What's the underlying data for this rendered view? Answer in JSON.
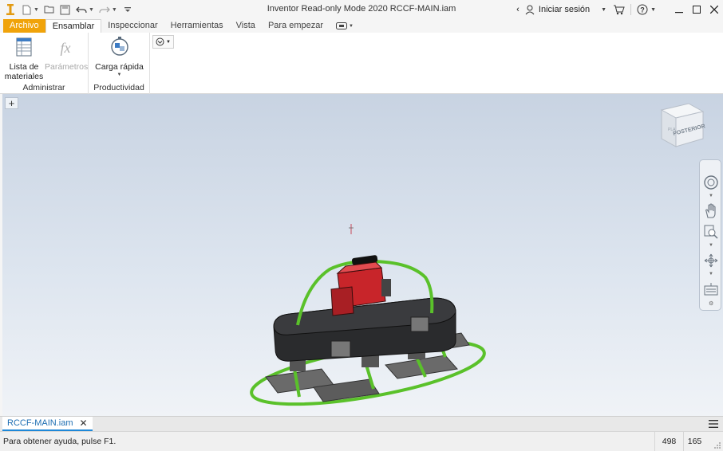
{
  "window": {
    "title": "Inventor Read-only Mode 2020   RCCF-MAIN.iam",
    "sign_in": "Iniciar sesión"
  },
  "tabs": [
    {
      "label": "Archivo"
    },
    {
      "label": "Ensamblar"
    },
    {
      "label": "Inspeccionar"
    },
    {
      "label": "Herramientas"
    },
    {
      "label": "Vista"
    },
    {
      "label": "Para empezar"
    }
  ],
  "ribbon": {
    "bom_label": "Lista de materiales",
    "params_label": "Parámetros",
    "quickload_label": "Carga rápida",
    "panel_manage": "Administrar",
    "panel_productivity": "Productividad"
  },
  "viewcube": {
    "face_label": "POSTERIOR"
  },
  "document_tab": {
    "label": "RCCF-MAIN.iam"
  },
  "status": {
    "help_text": "Para obtener ayuda, pulse F1.",
    "val1": "498",
    "val2": "165"
  },
  "colors": {
    "file_tab": "#f0a30a",
    "accent": "#1e88d8",
    "model_frame": "#5ac12a",
    "engine": "#c8252a"
  }
}
